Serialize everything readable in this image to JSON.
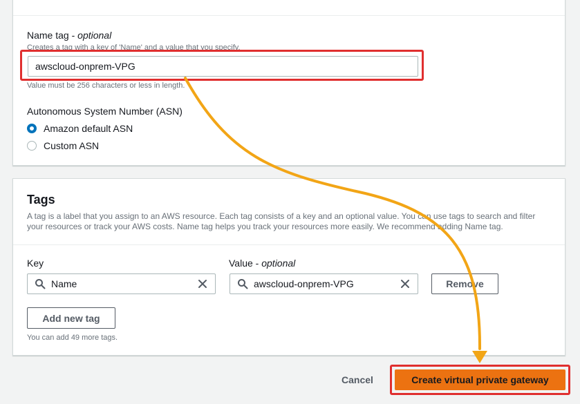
{
  "details": {
    "name_tag": {
      "label": "Name tag",
      "optional": "optional",
      "description": "Creates a tag with a key of 'Name' and a value that you specify.",
      "value": "awscloud-onprem-VPG",
      "constraint": "Value must be 256 characters or less in length."
    },
    "asn": {
      "label": "Autonomous System Number (ASN)",
      "options": [
        {
          "label": "Amazon default ASN",
          "selected": true
        },
        {
          "label": "Custom ASN",
          "selected": false
        }
      ]
    }
  },
  "tags": {
    "title": "Tags",
    "description": "A tag is a label that you assign to an AWS resource. Each tag consists of a key and an optional value. You can use tags to search and filter your resources or track your AWS costs. Name tag helps you track your resources more easily. We recommend adding Name tag.",
    "key_label": "Key",
    "value_label": "Value",
    "value_optional": "optional",
    "rows": [
      {
        "key": "Name",
        "value": "awscloud-onprem-VPG",
        "remove_label": "Remove"
      }
    ],
    "add_button": "Add new tag",
    "remaining_note": "You can add 49 more tags."
  },
  "footer": {
    "cancel_label": "Cancel",
    "create_label": "Create virtual private gateway"
  },
  "colors": {
    "primary_button": "#ec7211",
    "highlight": "#e02f2f",
    "annotation_arrow": "#f2a516",
    "radio_selected": "#0073bb"
  },
  "icons": [
    "search-icon",
    "clear-icon",
    "arrow-annotation"
  ]
}
